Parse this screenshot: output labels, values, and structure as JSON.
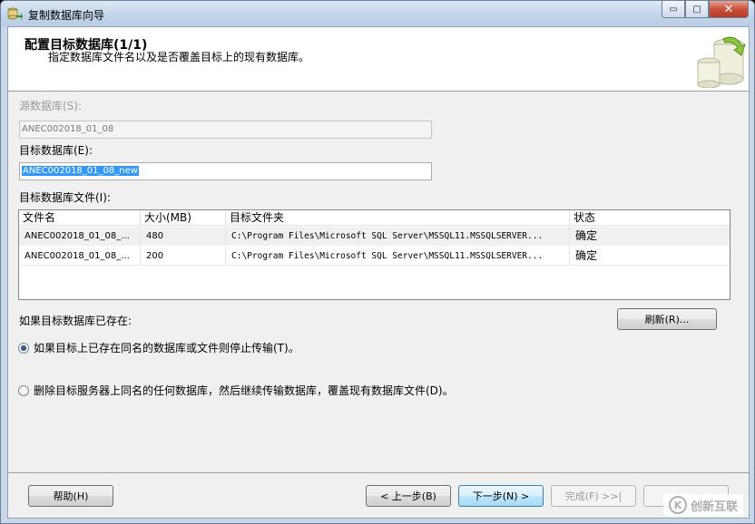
{
  "window": {
    "title": "复制数据库向导",
    "controls": {
      "minimize": "▭",
      "maximize": "□",
      "close": "✕"
    }
  },
  "header": {
    "title": "配置目标数据库(1/1)",
    "subtitle": "指定数据库文件名以及是否覆盖目标上的现有数据库。"
  },
  "form": {
    "source_label": "源数据库(S):",
    "source_value": "ANEC002018_01_08",
    "target_label": "目标数据库(E):",
    "target_value": "ANEC002018_01_08_new",
    "files_label": "目标数据库文件(I):"
  },
  "files_grid": {
    "columns": [
      "文件名",
      "大小(MB)",
      "目标文件夹",
      "状态"
    ],
    "rows": [
      {
        "name": "ANEC002018_01_08_...",
        "size": "480",
        "folder": "C:\\Program Files\\Microsoft SQL Server\\MSSQL11.MSSQLSERVER...",
        "status": "确定"
      },
      {
        "name": "ANEC002018_01_08_...",
        "size": "200",
        "folder": "C:\\Program Files\\Microsoft SQL Server\\MSSQL11.MSSQLSERVER...",
        "status": "确定"
      }
    ]
  },
  "exists": {
    "label": "如果目标数据库已存在:",
    "refresh_button": "刷新(R)...",
    "option_stop": "如果目标上已存在同名的数据库或文件则停止传输(T)。",
    "option_drop": "删除目标服务器上同名的任何数据库，然后继续传输数据库，覆盖现有数据库文件(D)。",
    "selected": "stop"
  },
  "footer": {
    "help": "帮助(H)",
    "back": "< 上一步(B)",
    "next": "下一步(N) >",
    "finish": "完成(F) >>|"
  },
  "watermark": {
    "logo_text": "K",
    "text": "创新互联"
  },
  "colors": {
    "selection": "#3399ff",
    "titlebar": "#c5d6ea",
    "client": "#f0f0f0"
  }
}
